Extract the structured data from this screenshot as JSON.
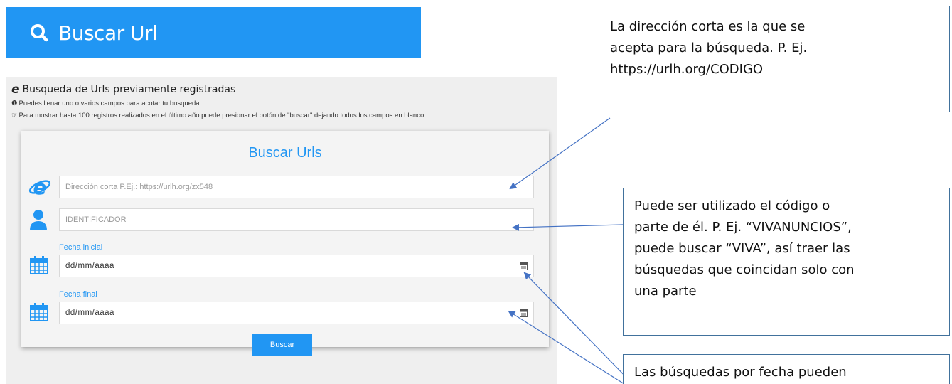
{
  "banner": {
    "title": "Buscar Url",
    "icon": "search-icon"
  },
  "panel": {
    "heading": "Busqueda de Urls previamente registradas",
    "note1": "Puedes llenar uno o varios campos para acotar tu busqueda",
    "note2": "Para mostrar hasta 100 registros realizados en el último año puede presionar el botón de \"buscar\" dejando todos los campos en blanco"
  },
  "form": {
    "title": "Buscar Urls",
    "url_placeholder": "Dirección corta P.Ej.: https://urlh.org/zx548",
    "id_placeholder": "IDENTIFICADOR",
    "start_label": "Fecha inicial",
    "start_value": "dd/mm/aaaa",
    "end_label": "Fecha final",
    "end_value": "dd/mm/aaaa",
    "search_button": "Buscar"
  },
  "callouts": {
    "c1": [
      "La dirección corta es la que se",
      "acepta para la búsqueda. P. Ej.",
      "https://urlh.org/CODIGO"
    ],
    "c2": [
      "Puede ser utilizado el código o",
      "parte de él. P. Ej. “VIVANUNCIOS”,",
      "puede buscar “VIVA”, así traer las",
      "búsquedas que coincidan solo con",
      "una parte"
    ],
    "c3": [
      "Las búsquedas por fecha pueden"
    ]
  },
  "colors": {
    "accent": "#2196f3",
    "callout_border": "#41719c",
    "panel_bg": "#efefef"
  }
}
